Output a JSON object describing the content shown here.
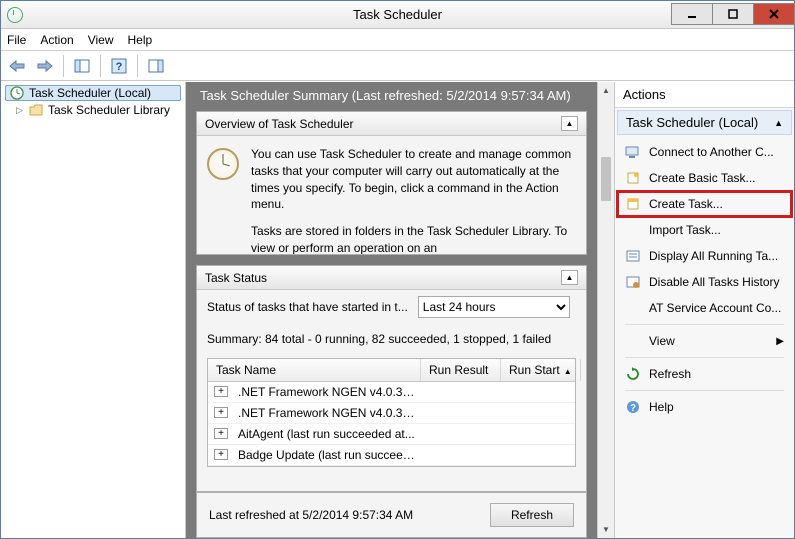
{
  "window": {
    "title": "Task Scheduler"
  },
  "menu": {
    "file": "File",
    "action": "Action",
    "view": "View",
    "help": "Help"
  },
  "tree": {
    "root": "Task Scheduler (Local)",
    "child": "Task Scheduler Library"
  },
  "center_title": "Task Scheduler Summary (Last refreshed: 5/2/2014 9:57:34 AM)",
  "overview": {
    "head": "Overview of Task Scheduler",
    "p1": "You can use Task Scheduler to create and manage common tasks that your computer will carry out automatically at the times you specify. To begin, click a command in the Action menu.",
    "p2": "Tasks are stored in folders in the Task Scheduler Library. To view or perform an operation on an"
  },
  "status": {
    "head": "Task Status",
    "label": "Status of tasks that have started in t...",
    "select_value": "Last 24 hours",
    "summary": "Summary: 84 total - 0 running, 82 succeeded, 1 stopped, 1 failed"
  },
  "grid": {
    "cols": {
      "c1": "Task Name",
      "c2": "Run Result",
      "c3": "Run Start"
    },
    "rows": [
      {
        "name": ".NET Framework NGEN v4.0.303..."
      },
      {
        "name": ".NET Framework NGEN v4.0.303..."
      },
      {
        "name": "AitAgent (last run succeeded at..."
      },
      {
        "name": "Badge Update (last run succeed..."
      }
    ]
  },
  "footer": {
    "text": "Last refreshed at 5/2/2014 9:57:34 AM",
    "button": "Refresh"
  },
  "actions": {
    "head": "Actions",
    "sub": "Task Scheduler (Local)",
    "items": {
      "connect": "Connect to Another C...",
      "create_basic": "Create Basic Task...",
      "create_task": "Create Task...",
      "import": "Import Task...",
      "display_running": "Display All Running Ta...",
      "disable_history": "Disable All Tasks History",
      "at_service": "AT Service Account Co...",
      "view": "View",
      "refresh": "Refresh",
      "help": "Help"
    }
  }
}
